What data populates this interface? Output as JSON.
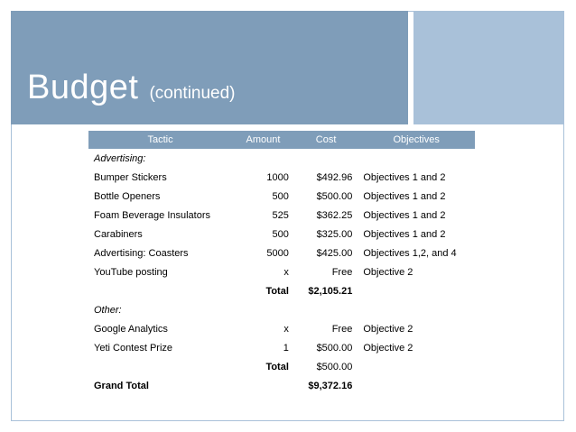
{
  "slide": {
    "title": "Budget",
    "subtitle": "(continued)"
  },
  "table": {
    "headers": {
      "tactic": "Tactic",
      "amount": "Amount",
      "cost": "Cost",
      "objectives": "Objectives"
    },
    "advertising": {
      "section_label": "Advertising:",
      "rows": [
        {
          "tactic": "Bumper Stickers",
          "amount": "1000",
          "cost": "$492.96",
          "objectives": "Objectives 1 and 2"
        },
        {
          "tactic": "Bottle Openers",
          "amount": "500",
          "cost": "$500.00",
          "objectives": "Objectives 1 and 2"
        },
        {
          "tactic": "Foam Beverage Insulators",
          "amount": "525",
          "cost": "$362.25",
          "objectives": "Objectives 1 and 2"
        },
        {
          "tactic": "Carabiners",
          "amount": "500",
          "cost": "$325.00",
          "objectives": "Objectives 1 and 2"
        },
        {
          "tactic": "Advertising: Coasters",
          "amount": "5000",
          "cost": "$425.00",
          "objectives": "Objectives 1,2, and 4"
        },
        {
          "tactic": "YouTube posting",
          "amount": "x",
          "cost": "Free",
          "objectives": "Objective 2"
        }
      ],
      "total_label": "Total",
      "total_value": "$2,105.21"
    },
    "other": {
      "section_label": "Other:",
      "rows": [
        {
          "tactic": "Google Analytics",
          "amount": "x",
          "cost": "Free",
          "objectives": "Objective 2"
        },
        {
          "tactic": "Yeti Contest Prize",
          "amount": "1",
          "cost": "$500.00",
          "objectives": "Objective 2"
        }
      ],
      "total_label": "Total",
      "total_value": "$500.00"
    },
    "grand_total_label": "Grand Total",
    "grand_total_value": "$9,372.16"
  },
  "colors": {
    "title_band": "#7f9db9",
    "accent_block": "#a9c1d9",
    "header_row": "#7f9db9"
  }
}
